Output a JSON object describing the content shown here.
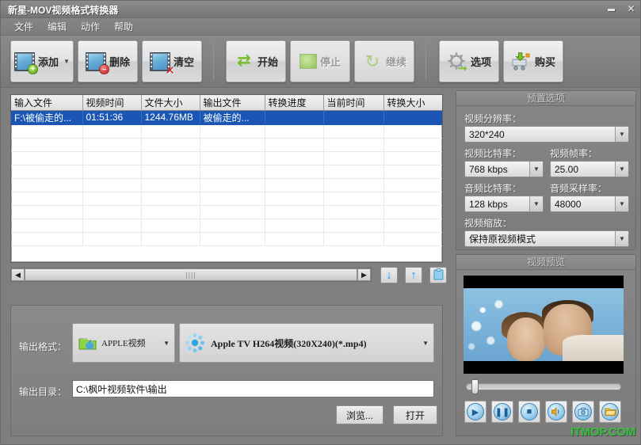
{
  "window": {
    "title": "新星-MOV视频格式转换器",
    "minimize_label": "—",
    "close_label": "✕"
  },
  "menu": {
    "items": [
      {
        "label": "文件"
      },
      {
        "label": "编辑"
      },
      {
        "label": "动作"
      },
      {
        "label": "帮助"
      }
    ]
  },
  "toolbar": {
    "buttons": [
      {
        "name": "add",
        "label": "添加",
        "icon": "film-add-icon",
        "enabled": true,
        "has_dropdown": true
      },
      {
        "name": "delete",
        "label": "删除",
        "icon": "film-remove-icon",
        "enabled": true,
        "has_dropdown": false
      },
      {
        "name": "clear",
        "label": "清空",
        "icon": "film-clear-icon",
        "enabled": true,
        "has_dropdown": false
      },
      {
        "name": "start",
        "label": "开始",
        "icon": "convert-arrows-icon",
        "enabled": true,
        "has_dropdown": false
      },
      {
        "name": "stop",
        "label": "停止",
        "icon": "stop-square-icon",
        "enabled": false,
        "has_dropdown": false
      },
      {
        "name": "resume",
        "label": "继续",
        "icon": "refresh-icon",
        "enabled": false,
        "has_dropdown": false
      },
      {
        "name": "options",
        "label": "选项",
        "icon": "gear-icon",
        "enabled": true,
        "has_dropdown": false
      },
      {
        "name": "buy",
        "label": "购买",
        "icon": "shopping-cart-icon",
        "enabled": true,
        "has_dropdown": false
      }
    ]
  },
  "filelist": {
    "columns": [
      "输入文件",
      "视频时间",
      "文件大小",
      "输出文件",
      "转换进度",
      "当前时间",
      "转换大小"
    ],
    "rows": [
      {
        "selected": true,
        "cells": [
          "F:\\被偷走的...",
          "01:51:36",
          "1244.76MB",
          "被偷走的...",
          "",
          "",
          ""
        ]
      }
    ],
    "empty_row_count": 9
  },
  "list_controls": {
    "scroll_left_label": "◀",
    "scroll_right_label": "▶",
    "scroll_grip": "||||",
    "move_down_label": "↓",
    "move_up_label": "↑",
    "clipboard_label": "📋"
  },
  "output": {
    "format_label": "输出格式：",
    "category_value": "APPLE视频",
    "profile_value": "Apple TV H264视频(320X240)(*.mp4)",
    "dropdown_arrow": "▼",
    "directory_label": "输出目录：",
    "directory_value": "C:\\枫叶视频软件\\输出",
    "browse_label": "浏览...",
    "open_label": "打开"
  },
  "preset": {
    "title": "预置选项",
    "fields": [
      {
        "label": "视频分辨率：",
        "value": "320*240"
      },
      {
        "label": "视频比特率：",
        "value": "768 kbps"
      },
      {
        "label": "视频帧率：",
        "value": "25.00"
      },
      {
        "label": "音频比特率：",
        "value": "128 kbps"
      },
      {
        "label": "音频采样率：",
        "value": "48000"
      },
      {
        "label": "视频缩放：",
        "value": "保持原视频模式"
      }
    ]
  },
  "preview": {
    "title": "视频预览",
    "seek_position_percent": 3,
    "buttons": [
      {
        "name": "play",
        "icon": "play-icon",
        "glyph": "▶"
      },
      {
        "name": "pause",
        "icon": "pause-icon",
        "glyph": "❚❚"
      },
      {
        "name": "stop",
        "icon": "stop-icon",
        "glyph": "■"
      },
      {
        "name": "volume",
        "icon": "speaker-icon",
        "glyph": "◀))"
      },
      {
        "name": "snapshot",
        "icon": "camera-icon",
        "glyph": "▣"
      },
      {
        "name": "open-folder",
        "icon": "folder-icon",
        "glyph": "▰"
      }
    ]
  },
  "watermark": {
    "text": "ITMOP.COM"
  },
  "colors": {
    "background": "#7f7f7f",
    "selection": "#1b56b5",
    "accent_green": "#76bc2a",
    "accent_blue": "#2196f3",
    "watermark_green": "#35c23a"
  }
}
